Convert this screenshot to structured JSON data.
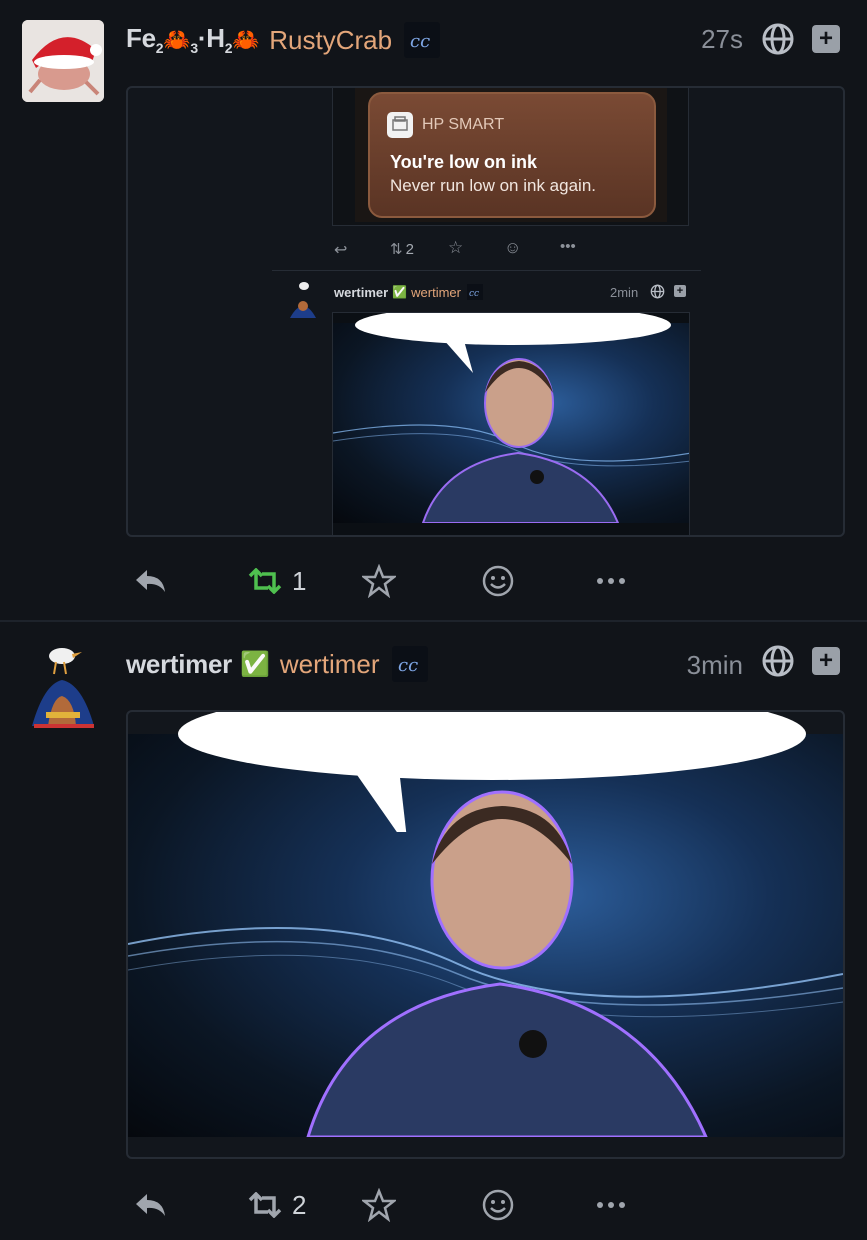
{
  "posts": [
    {
      "display_name_prefix": "Fe",
      "display_name_sub1": "2",
      "display_name_sub2": "3",
      "display_name_mid": "·H",
      "display_name_sub3": "2",
      "handle": "RustyCrab",
      "time": "27s",
      "badge": "cc-icon",
      "quoted": {
        "notification": {
          "app": "HP SMART",
          "title": "You're low on ink",
          "body": "Never run low on ink again."
        },
        "mini_boost_count": "2",
        "reply": {
          "display_name": "wertimer",
          "check": "✅",
          "handle": "wertimer",
          "time": "2min"
        }
      },
      "boost_count": "1"
    },
    {
      "display_name": "wertimer",
      "check": "✅",
      "handle": "wertimer",
      "time": "3min",
      "badge": "cc-icon",
      "boost_count": "2"
    }
  ],
  "colors": {
    "background": "#111419",
    "handle": "#e3a67a",
    "boosted": "#4fc04f"
  }
}
